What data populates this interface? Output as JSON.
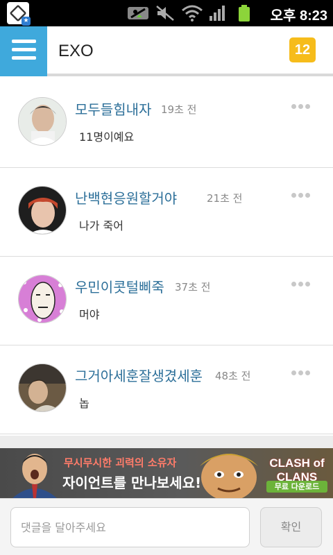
{
  "status_bar": {
    "time": "오후 8:23",
    "icons": [
      "app-notification-icon",
      "signal-blocked-icon",
      "mute-icon",
      "wifi-icon",
      "cell-signal-icon",
      "battery-icon"
    ]
  },
  "header": {
    "title": "EXO",
    "badge_count": "12",
    "accent_color": "#3fa9dc",
    "badge_color": "#f6bc1b"
  },
  "comments": [
    {
      "user": "모두들힘내자",
      "time": "19초 전",
      "text": "11명이예요"
    },
    {
      "user": "난백현응원할거야",
      "time": "21초 전",
      "text": "나가 죽어"
    },
    {
      "user": "우민이콧털삐죽",
      "time": "37초 전",
      "text": "머야"
    },
    {
      "user": "그거아세훈잘생겼세훈",
      "time": "48초 전",
      "text": "놉"
    }
  ],
  "ad": {
    "line1": "무시무시한 괴력의 소유자",
    "line2": "자이언트를 만나보세요!",
    "brand": "CLASH of CLANS",
    "button": "무료 다운로드"
  },
  "input_bar": {
    "placeholder": "댓글을 달아주세요",
    "confirm_label": "확인"
  }
}
